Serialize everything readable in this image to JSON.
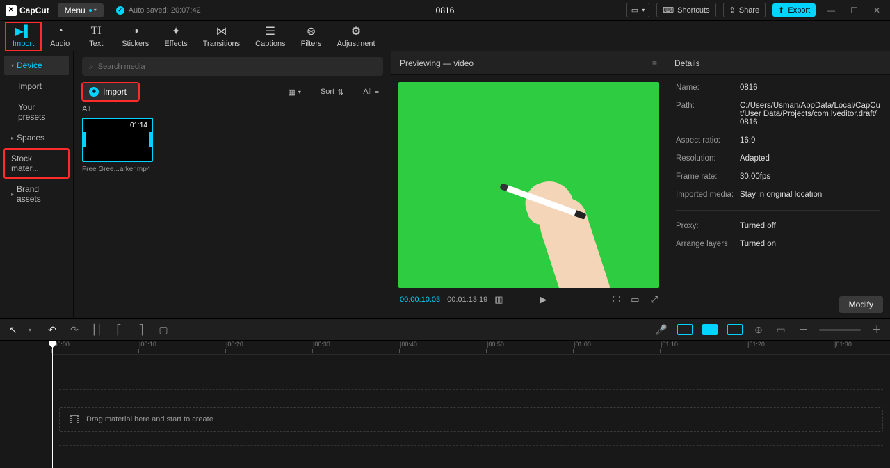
{
  "app": {
    "name": "CapCut",
    "menu_label": "Menu",
    "autosave_label": "Auto saved: 20:07:42",
    "project_title": "0816"
  },
  "topbar": {
    "shortcuts": "Shortcuts",
    "share": "Share",
    "export": "Export"
  },
  "tooltabs": {
    "import": "Import",
    "audio": "Audio",
    "text": "Text",
    "stickers": "Stickers",
    "effects": "Effects",
    "transitions": "Transitions",
    "captions": "Captions",
    "filters": "Filters",
    "adjustment": "Adjustment"
  },
  "sidebar": {
    "device": "Device",
    "import": "Import",
    "presets": "Your presets",
    "spaces": "Spaces",
    "stock": "Stock mater...",
    "brand": "Brand assets"
  },
  "media": {
    "search_placeholder": "Search media",
    "import_btn": "Import",
    "sort": "Sort",
    "all": "All",
    "all_header": "All",
    "thumb_duration": "01:14",
    "thumb_name": "Free Gree...arker.mp4"
  },
  "preview": {
    "title": "Previewing — video",
    "cur_time": "00:00:10:03",
    "dur_time": "00:01:13:19"
  },
  "details": {
    "title": "Details",
    "name_l": "Name:",
    "name_v": "0816",
    "path_l": "Path:",
    "path_v": "C:/Users/Usman/AppData/Local/CapCut/User Data/Projects/com.lveditor.draft/0816",
    "aspect_l": "Aspect ratio:",
    "aspect_v": "16:9",
    "res_l": "Resolution:",
    "res_v": "Adapted",
    "fps_l": "Frame rate:",
    "fps_v": "30.00fps",
    "imp_l": "Imported media:",
    "imp_v": "Stay in original location",
    "proxy_l": "Proxy:",
    "proxy_v": "Turned off",
    "layers_l": "Arrange layers",
    "layers_v": "Turned on",
    "modify": "Modify"
  },
  "timeline": {
    "ticks": [
      "00:00",
      "00:10",
      "00:20",
      "00:30",
      "00:40",
      "00:50",
      "01:00",
      "01:10",
      "01:20",
      "01:30"
    ],
    "drop_hint": "Drag material here and start to create"
  }
}
